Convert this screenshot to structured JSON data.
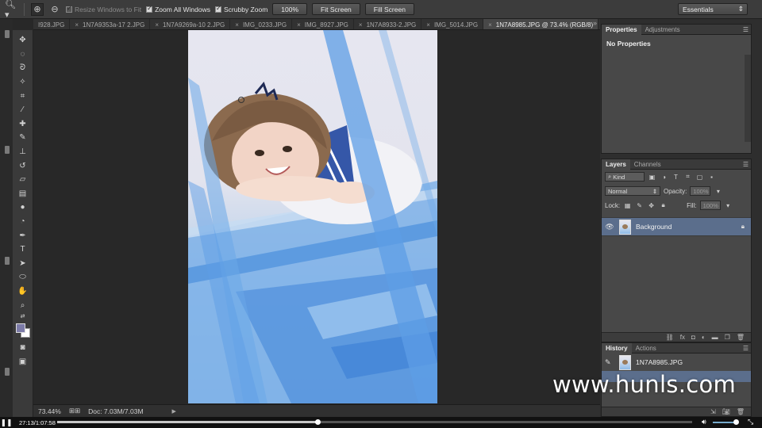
{
  "options_bar": {
    "resize_windows_label": "Resize Windows to Fit",
    "zoom_all_windows_label": "Zoom All Windows",
    "scrubby_zoom_label": "Scrubby Zoom",
    "zoom_100_label": "100%",
    "fit_screen_label": "Fit Screen",
    "fill_screen_label": "Fill Screen",
    "workspace_label": "Essentials"
  },
  "tabs": [
    {
      "label": "I928.JPG",
      "active": false
    },
    {
      "label": "1N7A9353a-17 2.JPG",
      "active": false
    },
    {
      "label": "1N7A9269a-10 2.JPG",
      "active": false
    },
    {
      "label": "IMG_0233.JPG",
      "active": false
    },
    {
      "label": "IMG_8927.JPG",
      "active": false
    },
    {
      "label": "1N7A8933-2.JPG",
      "active": false
    },
    {
      "label": "IMG_5014.JPG",
      "active": false
    },
    {
      "label": "1N7A8985.JPG @ 73.4% (RGB/8)",
      "active": true
    }
  ],
  "tab_overflow": "»",
  "status": {
    "zoom": "73.44%",
    "doc": "Doc: 7.03M/7.03M"
  },
  "properties": {
    "tab_properties": "Properties",
    "tab_adjustments": "Adjustments",
    "content": "No Properties"
  },
  "layers": {
    "tab_layers": "Layers",
    "tab_channels": "Channels",
    "kind_label": "Kind",
    "blend_mode": "Normal",
    "opacity_label": "Opacity:",
    "opacity_value": "100%",
    "lock_label": "Lock:",
    "fill_label": "Fill:",
    "fill_value": "100%",
    "items": [
      {
        "name": "Background"
      }
    ]
  },
  "history": {
    "tab_history": "History",
    "tab_actions": "Actions",
    "snapshot_name": "1N7A8985.JPG"
  },
  "watermark": "www.hunls.com",
  "player": {
    "time": "27:13/1:07:58",
    "progress": 0.41
  }
}
